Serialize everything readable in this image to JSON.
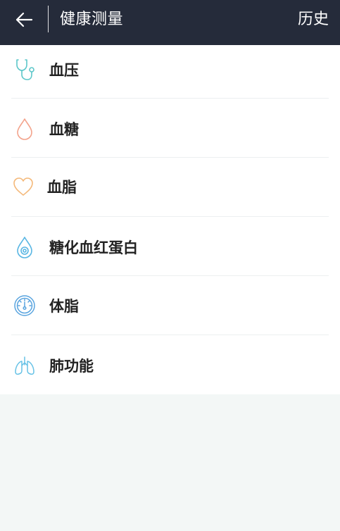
{
  "header": {
    "back_icon": "arrow-left-icon",
    "title": "健康测量",
    "history_label": "历史"
  },
  "items": [
    {
      "label": "血压",
      "icon": "stethoscope-icon",
      "color": "#5cc7c9"
    },
    {
      "label": "血糖",
      "icon": "blood-drop-icon",
      "color": "#f3a38c"
    },
    {
      "label": "血脂",
      "icon": "heart-icon",
      "color": "#f4b879"
    },
    {
      "label": "糖化血红蛋白",
      "icon": "drop-target-icon",
      "color": "#59b6e3"
    },
    {
      "label": "体脂",
      "icon": "gauge-icon",
      "color": "#59a4df"
    },
    {
      "label": "肺功能",
      "icon": "lungs-icon",
      "color": "#67c2e6"
    }
  ],
  "colors": {
    "header_bg": "#252b3a",
    "page_bg": "#f3f7f6",
    "separator": "#eceff0"
  }
}
